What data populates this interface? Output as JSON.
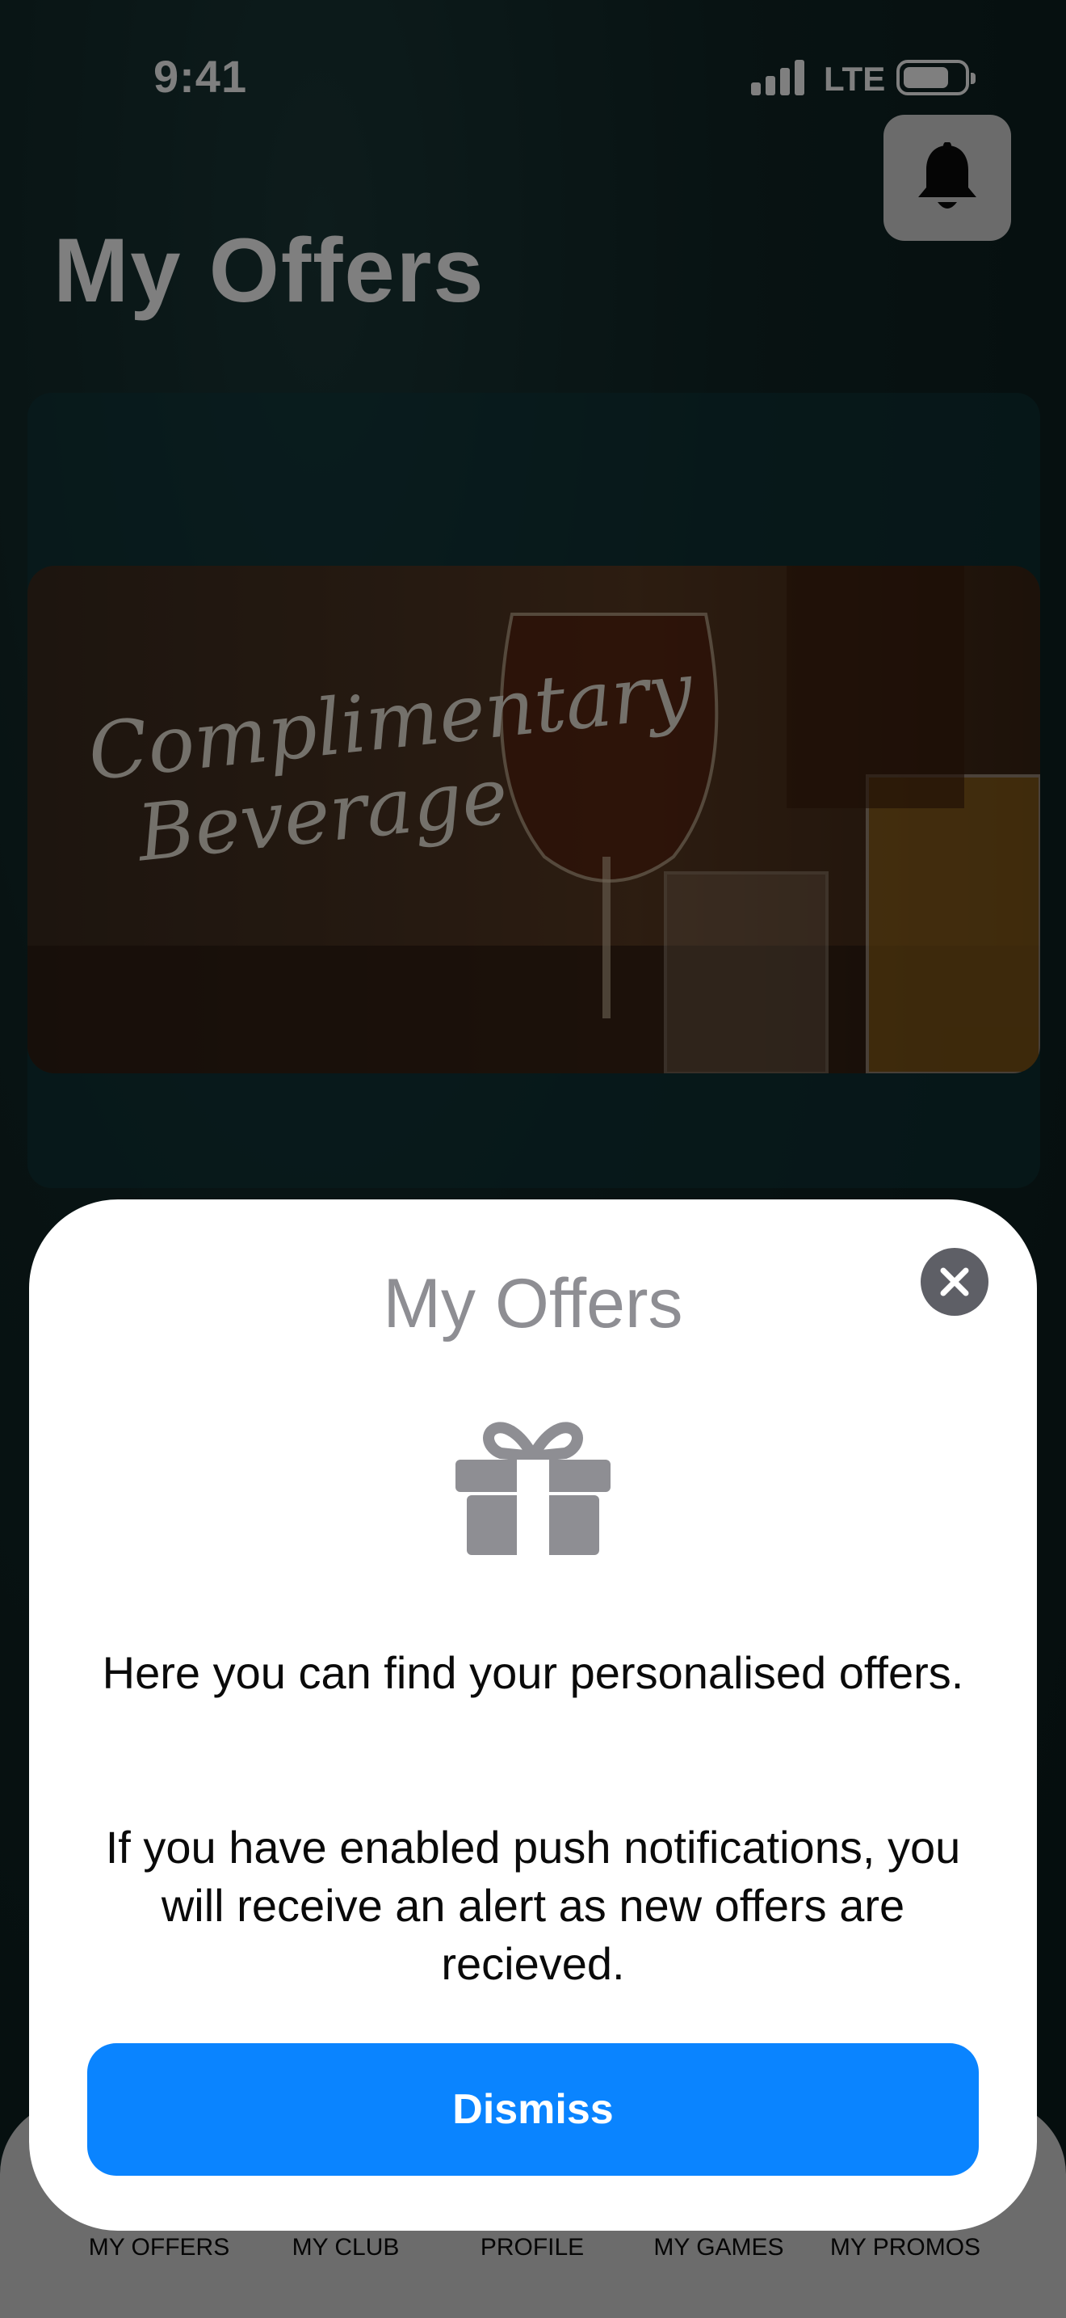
{
  "status_bar": {
    "time": "9:41",
    "network": "LTE"
  },
  "header": {
    "title": "My Offers"
  },
  "offers": [
    {
      "image_text": "Complimentary Beverage"
    }
  ],
  "modal": {
    "title": "My Offers",
    "paragraph1": "Here you can find your personalised offers.",
    "paragraph2": "If you have enabled push notifications, you will receive an alert as new offers are recieved.",
    "dismiss_label": "Dismiss"
  },
  "tab_bar": {
    "items": [
      {
        "label": "MY OFFERS"
      },
      {
        "label": "MY CLUB"
      },
      {
        "label": "PROFILE"
      },
      {
        "label": "MY GAMES"
      },
      {
        "label": "MY PROMOS"
      }
    ]
  },
  "colors": {
    "accent": "#0a84ff",
    "close_button": "#5e5f66",
    "icon_gray": "#8e8e93"
  },
  "icons": [
    "bell-icon",
    "gift-icon",
    "close-icon",
    "signal-icon",
    "battery-icon"
  ]
}
